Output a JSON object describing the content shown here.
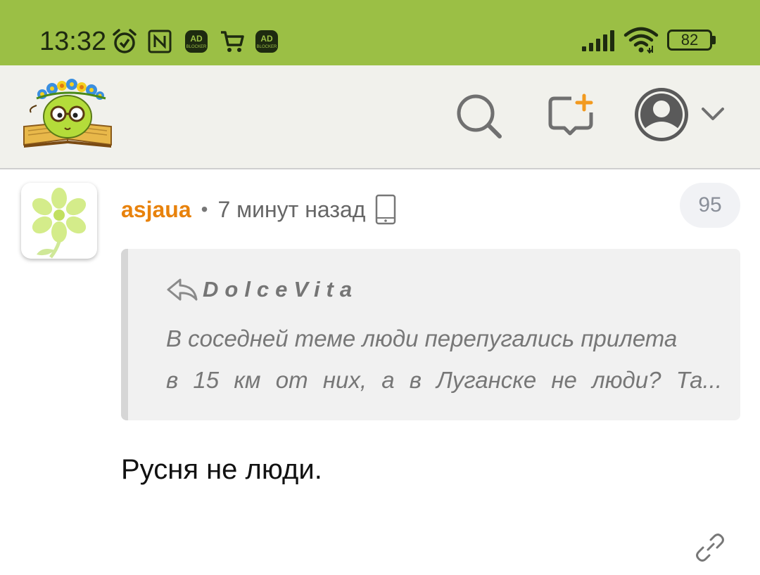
{
  "status_bar": {
    "time": "13:32",
    "battery": "82",
    "icons": [
      "alarm-icon",
      "nfc-icon",
      "adblocker-icon",
      "cart-icon",
      "adblocker-icon",
      "signal-icon",
      "wifi-icon",
      "battery-icon"
    ],
    "adblock_label": "AD",
    "adblock_sublabel": "BLOCKER",
    "background": "#9bbf45"
  },
  "header": {
    "icons": [
      "site-logo",
      "search-icon",
      "new-message-icon",
      "user-avatar-icon",
      "chevron-down-icon"
    ],
    "accent": "#f29a1f"
  },
  "comment": {
    "author": "asjaua",
    "separator": "•",
    "time_ago": "7 минут назад",
    "device_icon": "mobile-phone-icon",
    "count": "95",
    "quote": {
      "author": "DolceVita",
      "line1": "В соседней теме люди перепугались прилета",
      "line2": "в 15 км от них, а в Луганске не люди? Та..."
    },
    "body": "Русня не люди.",
    "link_icon": "link-icon",
    "author_color": "#e8820c"
  }
}
